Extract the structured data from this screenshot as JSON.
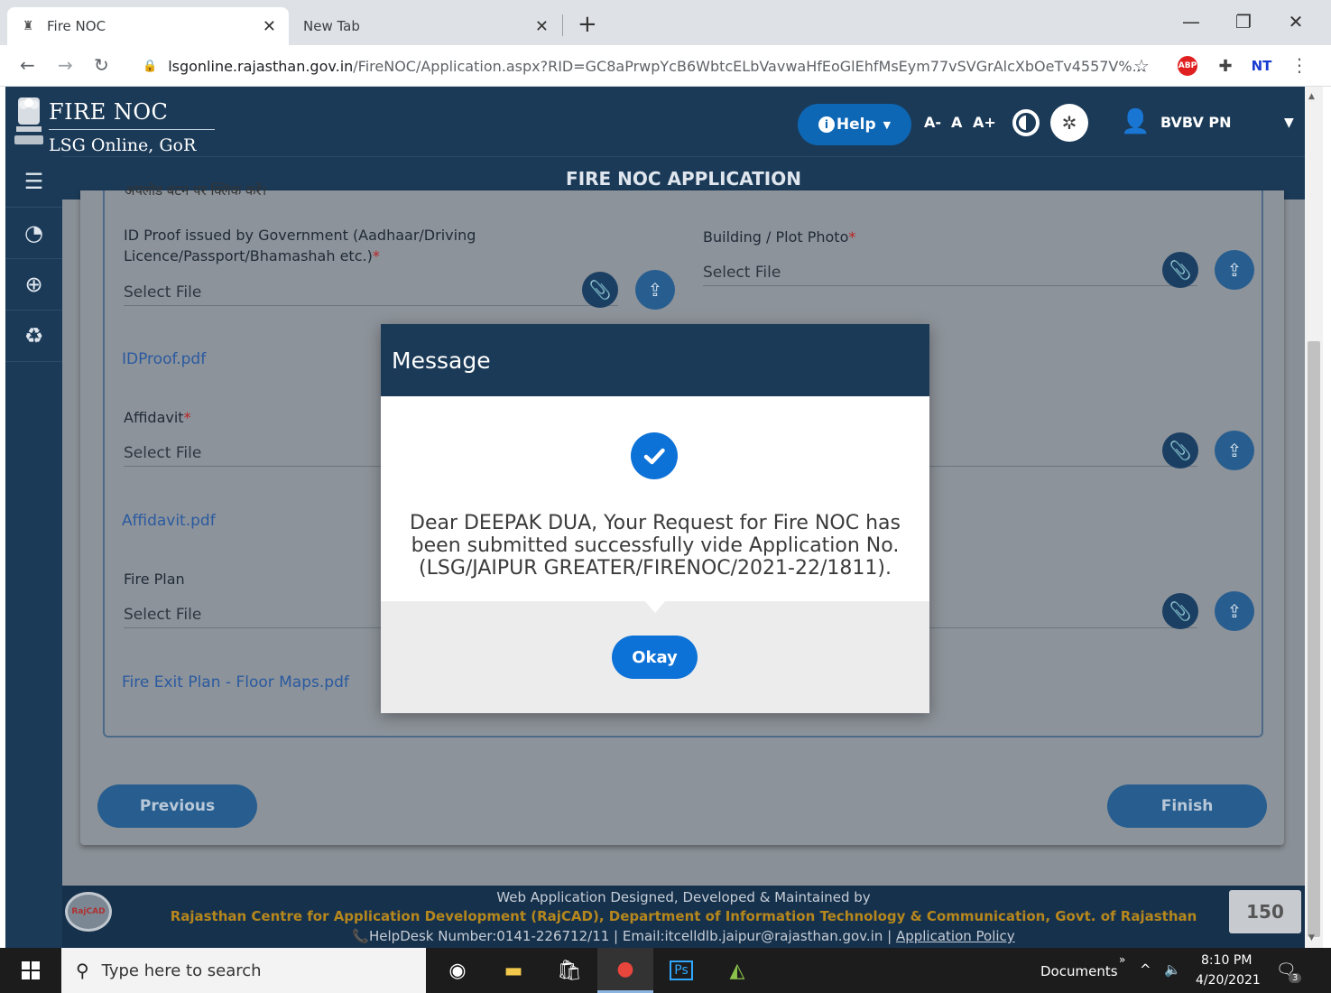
{
  "browser": {
    "tabs": [
      {
        "title": "Fire NOC",
        "active": true
      },
      {
        "title": "New Tab",
        "active": false
      }
    ],
    "url_host": "lsgonline.rajasthan.gov.in",
    "url_path": "/FireNOC/Application.aspx?RID=GC8aPrwpYcB6WbtcELbVavwaHfEoGlEhfMsEym77vSVGrAlcXbOeTv4557V%...",
    "ext_abp": "ABP",
    "ext_nj": "NT"
  },
  "header": {
    "brand_title": "FIRE NOC",
    "brand_subtitle": "LSG Online, GoR",
    "help_label": "Help",
    "font_small": "A-",
    "font_normal": "A",
    "font_large": "A+",
    "user_name": "BVBV PN"
  },
  "page_title": "FIRE NOC APPLICATION",
  "form": {
    "cut_text": "अपलोड बटन पर क्लिक करें।",
    "id_proof_label": "ID Proof issued by Government (Aadhaar/Driving Licence/Passport/Bhamashah etc.)",
    "building_photo_label": "Building / Plot Photo",
    "affidavit_label": "Affidavit",
    "fire_plan_label": "Fire Plan",
    "select_file": "Select File",
    "required_mark": "*",
    "id_proof_file": "IDProof.pdf",
    "affidavit_file": "Affidavit.pdf",
    "fire_plan_file": "Fire Exit Plan - Floor Maps.pdf",
    "previous_label": "Previous",
    "finish_label": "Finish"
  },
  "modal": {
    "title": "Message",
    "message": "Dear DEEPAK DUA, Your Request for Fire NOC has been submitted successfully vide Application No. (LSG/JAIPUR GREATER/FIRENOC/2021-22/1811).",
    "okay_label": "Okay"
  },
  "footer": {
    "line1": "Web Application Designed, Developed & Maintained by",
    "line2": "Rajasthan Centre for Application Development (RajCAD), Department of Information Technology & Communication, Govt. of Rajasthan",
    "line3": "HelpDesk Number:0141-226712/11 | Email:itcelldlb.jaipur@rajasthan.gov.in |",
    "policy_link": "Application Policy",
    "rajcad_logo_text": "RajCAD",
    "logo_150_text": "150"
  },
  "taskbar": {
    "search_placeholder": "Type here to search",
    "documents_label": "Documents",
    "time": "8:10 PM",
    "date": "4/20/2021",
    "notification_count": "3",
    "ps_label": "Ps"
  },
  "colors": {
    "header_navy": "#1b3a57",
    "primary_blue": "#0d72d8",
    "footer_gold": "#b5871d"
  }
}
